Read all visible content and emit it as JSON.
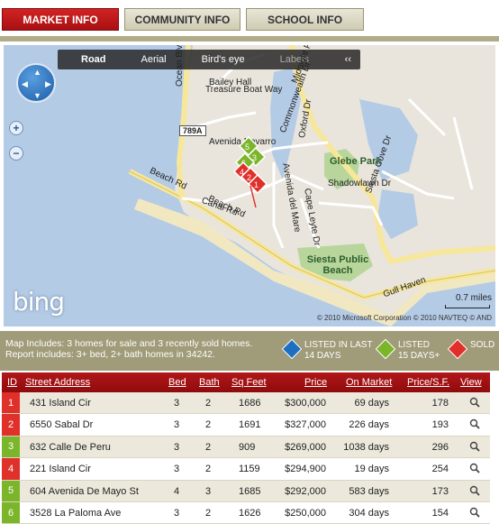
{
  "tabs": [
    {
      "label": "MARKET INFO",
      "active": true
    },
    {
      "label": "COMMUNITY INFO",
      "active": false
    },
    {
      "label": "SCHOOL INFO",
      "active": false
    }
  ],
  "map": {
    "toolbar": [
      "Road",
      "Aerial",
      "Bird's eye",
      "Labels"
    ],
    "collapse": "‹‹",
    "logo": "bing",
    "scale_label": "0.7 miles",
    "copyright": "© 2010 Microsoft Corporation   © 2010 NAVTEQ   © AND",
    "street_labels": [
      "Treasure Boat Way",
      "Ocean Blvd",
      "Commonwealth Dr",
      "Oxford Dr",
      "Siesta Cove Dr",
      "Shadowlawn Dr",
      "Avenida del Mare",
      "Cape Leyte Dr",
      "Beach Rd",
      "Canal Rd",
      "Avenida Navarro",
      "Beach Rd",
      "Gull Haven",
      "Bailey Hall",
      "Midnight Pass Rd"
    ],
    "parks": [
      "Glebe Park",
      "Siesta Public Beach"
    ],
    "route_shield": "789A",
    "markers": [
      {
        "id": "5",
        "type": "listed_15plus"
      },
      {
        "id": "3",
        "type": "listed_15plus"
      },
      {
        "id": "6",
        "type": "listed_15plus"
      },
      {
        "id": "4",
        "type": "sold"
      },
      {
        "id": "2",
        "type": "sold"
      },
      {
        "id": "1",
        "type": "sold"
      }
    ]
  },
  "legend": {
    "line1": "Map Includes: 3 homes for sale and 3 recently sold homes.",
    "line2": "Report includes: 3+ bed, 2+ bath homes in 34242.",
    "keys": [
      {
        "label": "LISTED IN LAST",
        "label2": "14 DAYS",
        "color": "#1f6fc0"
      },
      {
        "label": "LISTED",
        "label2": "15 DAYS+",
        "color": "#7bb52a"
      },
      {
        "label": "SOLD",
        "label2": "",
        "color": "#e0302a"
      }
    ]
  },
  "table": {
    "headers": [
      "ID",
      "Street Address",
      "Bed",
      "Bath",
      "Sq Feet",
      "Price",
      "On Market",
      "Price/S.F.",
      "View"
    ],
    "rows": [
      {
        "id": "1",
        "color": "#e0302a",
        "address": "431 Island Cir",
        "bed": "3",
        "bath": "2",
        "sqft": "1686",
        "price": "$300,000",
        "market": "69 days",
        "psf": "178"
      },
      {
        "id": "2",
        "color": "#e0302a",
        "address": "6550 Sabal Dr",
        "bed": "3",
        "bath": "2",
        "sqft": "1691",
        "price": "$327,000",
        "market": "226 days",
        "psf": "193"
      },
      {
        "id": "3",
        "color": "#7bb52a",
        "address": "632 Calle De Peru",
        "bed": "3",
        "bath": "2",
        "sqft": "909",
        "price": "$269,000",
        "market": "1038 days",
        "psf": "296"
      },
      {
        "id": "4",
        "color": "#e0302a",
        "address": "221 Island Cir",
        "bed": "3",
        "bath": "2",
        "sqft": "1159",
        "price": "$294,900",
        "market": "19 days",
        "psf": "254"
      },
      {
        "id": "5",
        "color": "#7bb52a",
        "address": "604 Avenida De Mayo St",
        "bed": "4",
        "bath": "3",
        "sqft": "1685",
        "price": "$292,000",
        "market": "583 days",
        "psf": "173"
      },
      {
        "id": "6",
        "color": "#7bb52a",
        "address": "3528 La Paloma Ave",
        "bed": "3",
        "bath": "2",
        "sqft": "1626",
        "price": "$250,000",
        "market": "304 days",
        "psf": "154"
      }
    ],
    "view_icon": "magnifier-icon"
  }
}
